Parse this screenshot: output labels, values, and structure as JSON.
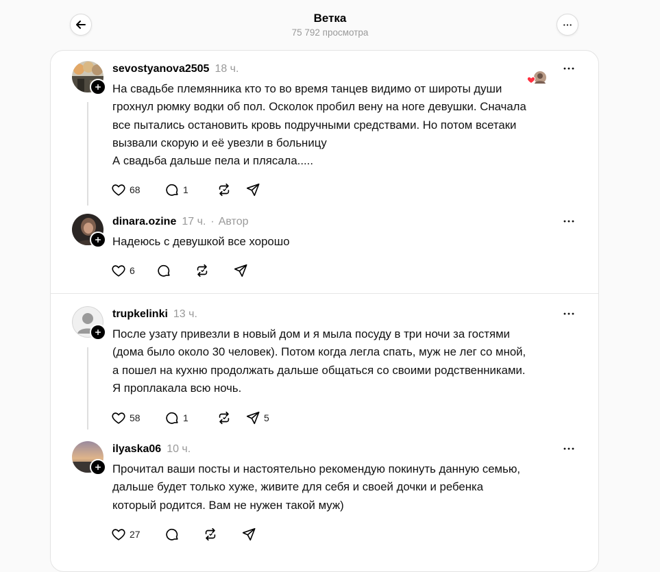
{
  "header": {
    "title": "Ветка",
    "views": "75 792 просмотра"
  },
  "colors": {
    "background": "#fafafa",
    "card": "#ffffff",
    "muted_text": "#999999",
    "thread_line": "#dedede",
    "heart_red": "#ff3040"
  },
  "posts": [
    {
      "username": "sevostyanova2505",
      "time": "18 ч.",
      "lines": [
        "На свадьбе племянника кто то во время танцев видимо от широты души",
        "грохнул рюмку водки об пол. Осколок пробил вену на ноге девушки. Сначала",
        "все пытались остановить кровь подручными средствами. Но потом всетаки",
        "вызвали скорую и её увезли в больницу",
        "А свадьба дальше пела и плясала....."
      ],
      "likes": "68",
      "replies": "1",
      "reposts": "",
      "shares": ""
    },
    {
      "username": "dinara.ozine",
      "time": "17 ч.",
      "separator": "·",
      "author_label": "Автор",
      "lines": [
        "Надеюсь с девушкой все хорошо"
      ],
      "likes": "6",
      "replies": "",
      "reposts": "",
      "shares": ""
    },
    {
      "username": "trupkelinki",
      "time": "13 ч.",
      "lines": [
        "После узату привезли в новый дом и я мыла посуду в три ночи за гостями",
        "(дома было около 30 человек). Потом когда легла спать, муж не лег со мной,",
        "а пошел на кухню продолжать дальше общаться со своими родственниками.",
        "Я проплакала всю ночь."
      ],
      "likes": "58",
      "replies": "1",
      "reposts": "",
      "shares": "5"
    },
    {
      "username": "ilyaska06",
      "time": "10 ч.",
      "lines": [
        "Прочитал ваши посты и настоятельно рекомендую покинуть данную семью,",
        "дальше будет только хуже, живите для себя и своей дочки и ребенка",
        "который родится. Вам не нужен такой муж)"
      ],
      "likes": "27",
      "replies": "",
      "reposts": "",
      "shares": ""
    }
  ]
}
